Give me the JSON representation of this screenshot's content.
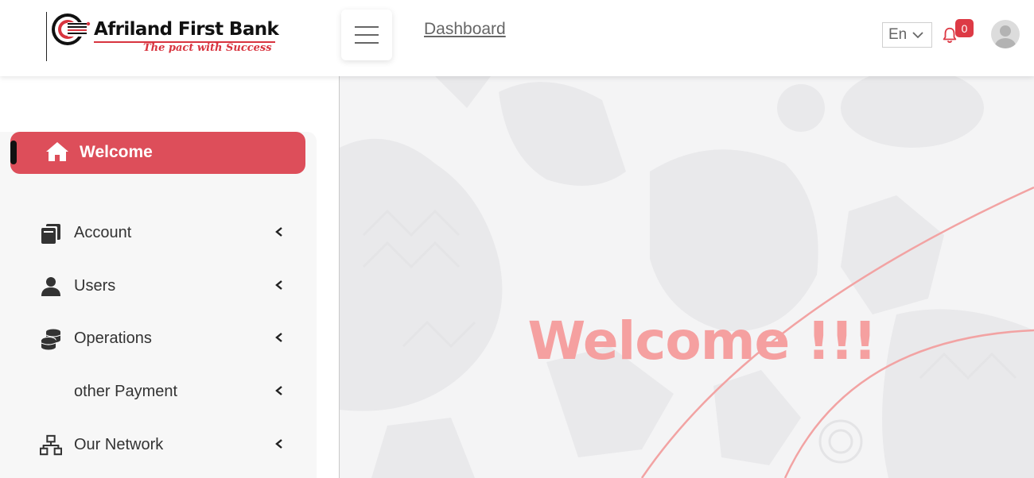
{
  "header": {
    "logo": {
      "name": "Afriland First Bank",
      "tagline": "The pact with Success"
    },
    "breadcrumb": "Dashboard",
    "language": "En",
    "notifications_count": "0"
  },
  "sidebar": {
    "active": {
      "label": "Welcome",
      "icon": "home-icon"
    },
    "items": [
      {
        "label": "Account",
        "icon": "account-icon"
      },
      {
        "label": "Users",
        "icon": "user-icon"
      },
      {
        "label": "Operations",
        "icon": "coins-icon"
      },
      {
        "label": "other Payment",
        "icon": ""
      },
      {
        "label": "Our Network",
        "icon": "network-icon"
      }
    ]
  },
  "main": {
    "welcome_message": "Welcome !!!"
  },
  "colors": {
    "brand_red": "#dd4e5a",
    "badge_red": "#dd3a45",
    "welcome_pink": "#f5a0a0"
  }
}
